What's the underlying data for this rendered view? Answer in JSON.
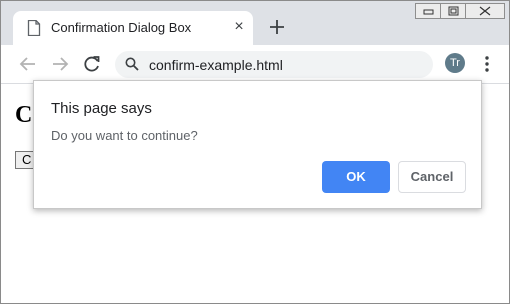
{
  "browser": {
    "tab": {
      "title": "Confirmation Dialog Box",
      "close_glyph": "×"
    },
    "address_bar": {
      "url": "confirm-example.html"
    },
    "profile": {
      "initials": "Tr"
    }
  },
  "page": {
    "heading": "C",
    "button_label": "C"
  },
  "dialog": {
    "title": "This page says",
    "message": "Do you want to continue?",
    "ok_label": "OK",
    "cancel_label": "Cancel"
  },
  "colors": {
    "tabstrip": "#dee1e6",
    "ok_button": "#4285f4",
    "avatar": "#5f7b8a"
  }
}
